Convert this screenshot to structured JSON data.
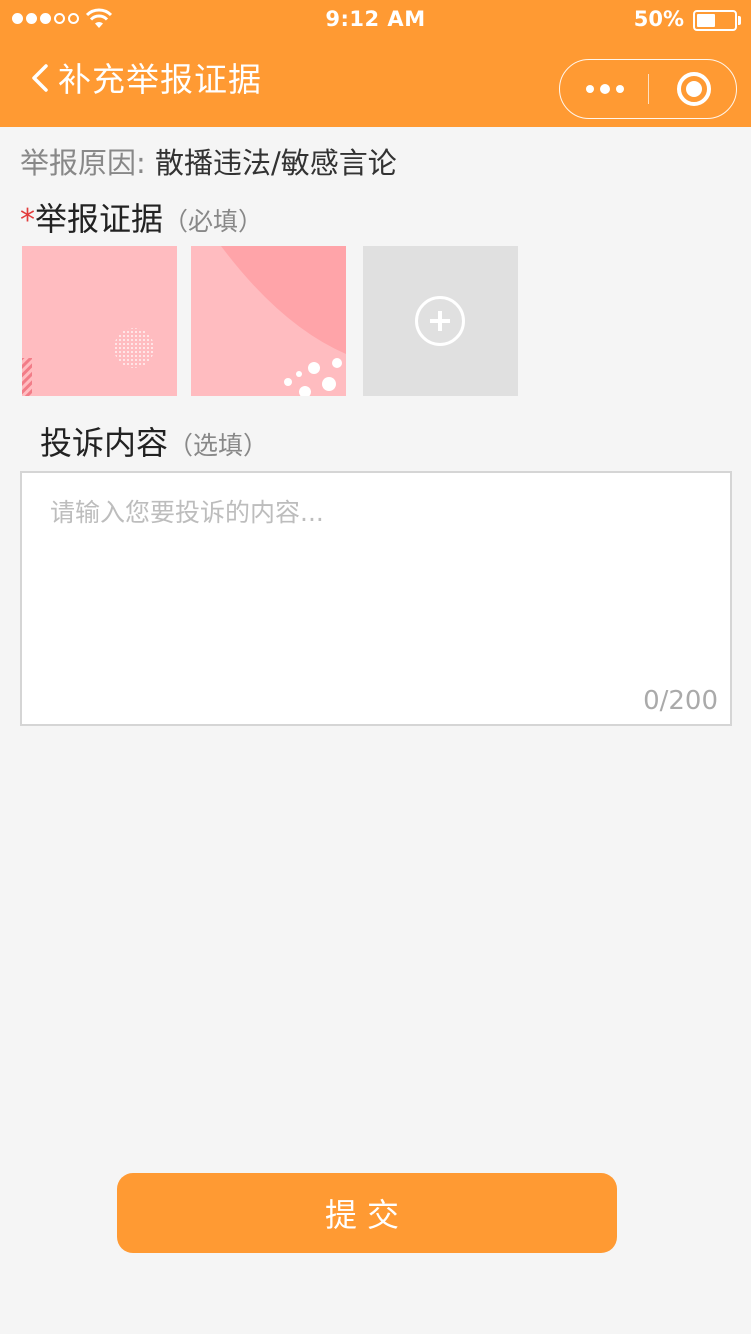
{
  "status_bar": {
    "time": "9:12 AM",
    "battery_percent": "50%",
    "battery_level": 0.5,
    "signal_bars_filled": 3,
    "signal_bars_total": 5
  },
  "nav": {
    "title": "补充举报证据",
    "back_icon": "chevron-left-icon",
    "more_icon": "more-dots-icon",
    "close_icon": "circle-target-icon"
  },
  "report": {
    "reason_label": "举报原因:",
    "reason_value": "散播违法/敏感言论"
  },
  "evidence": {
    "required_mark": "*",
    "title": "举报证据",
    "hint": "（必填）",
    "add_icon": "plus-circle-icon"
  },
  "complaint": {
    "title": "投诉内容",
    "hint": "（选填）",
    "placeholder": "请输入您要投诉的内容...",
    "value": "",
    "counter": "0/200"
  },
  "submit_label": "提交",
  "colors": {
    "accent": "#ff9a33",
    "required": "#e23b3b",
    "thumb_pink": "#ffbcc0"
  }
}
